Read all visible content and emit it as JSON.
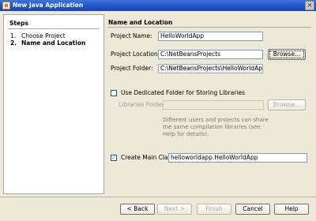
{
  "window": {
    "title": "New Java Application",
    "close_label": "×"
  },
  "steps": {
    "header": "Steps",
    "items": [
      {
        "num": "1.",
        "label": "Choose Project",
        "current": false
      },
      {
        "num": "2.",
        "label": "Name and Location",
        "current": true
      }
    ]
  },
  "content": {
    "header": "Name and Location",
    "project_name_label": "Project Name:",
    "project_name_value": "HelloWorldApp",
    "project_location_label": "Project Location:",
    "project_location_value": "C:\\NetBeansProjects",
    "browse_label": "Browse...",
    "project_folder_label": "Project Folder:",
    "project_folder_value": "C:\\NetBeansProjects\\HelloWorldApp",
    "dedicated_folder_label": "Use Dedicated Folder for Storing Libraries",
    "dedicated_folder_checked": false,
    "libraries_folder_label": "Libraries Folder:",
    "libraries_folder_value": "",
    "libraries_browse_label": "Browse...",
    "libraries_help": "Different users and projects can share the same compilation libraries (see Help for details).",
    "create_main_class_label": "Create Main Class",
    "create_main_class_checked": true,
    "main_class_value": "helloworldapp.HelloWorldApp"
  },
  "buttons": {
    "back": "< Back",
    "next": "Next >",
    "finish": "Finish",
    "cancel": "Cancel",
    "help": "Help"
  }
}
